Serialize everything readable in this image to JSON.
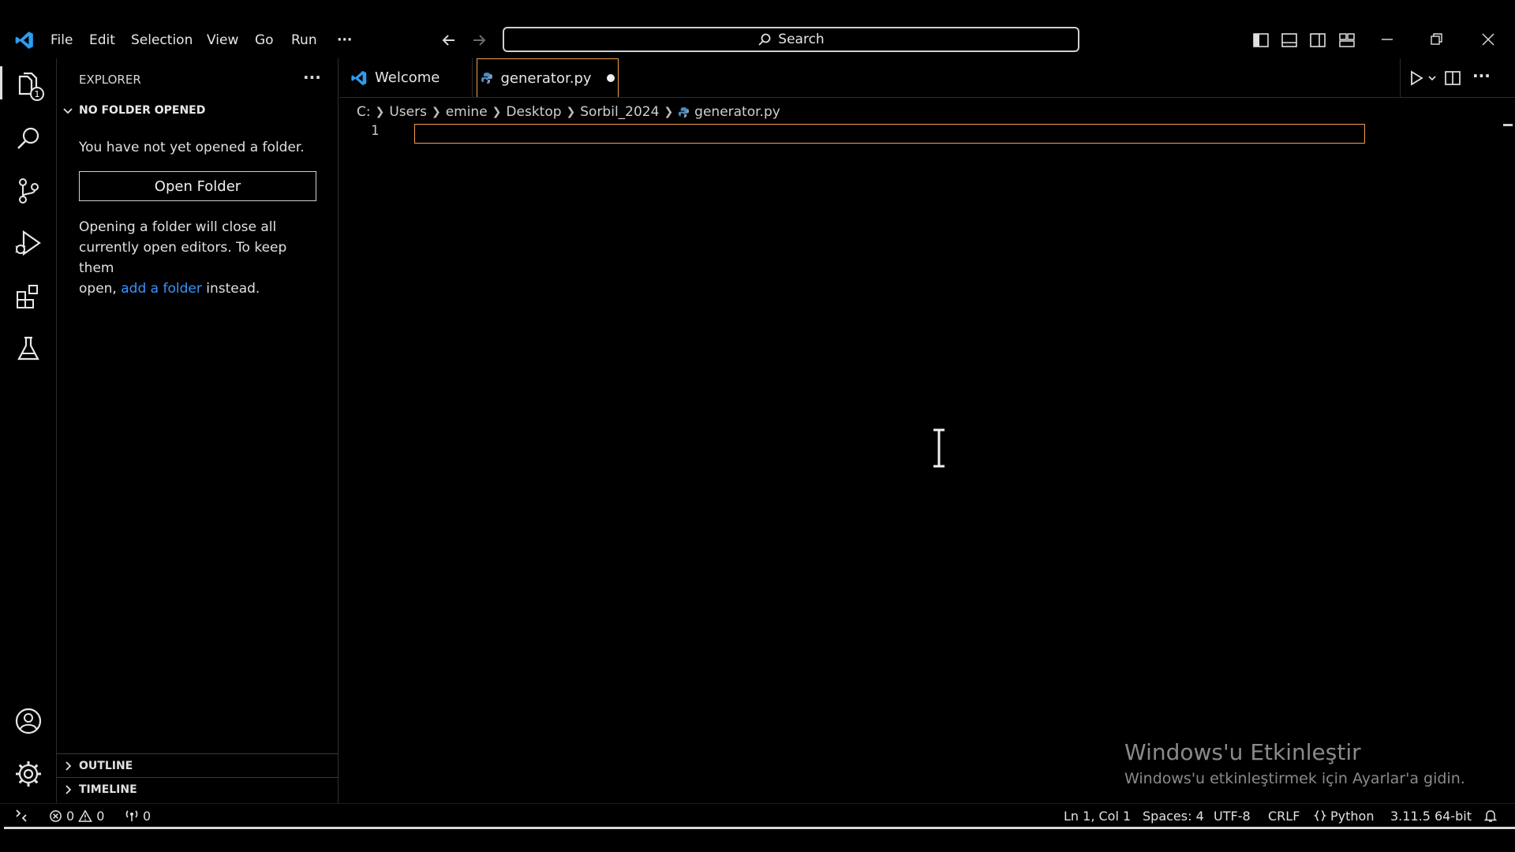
{
  "menu": [
    "File",
    "Edit",
    "Selection",
    "View",
    "Go",
    "Run",
    "···"
  ],
  "search": {
    "label": "Search"
  },
  "activity": {
    "explorer_badge": "1"
  },
  "sidebar": {
    "title": "EXPLORER",
    "more": "···",
    "section_title": "NO FOLDER OPENED",
    "message": "You have not yet opened a folder.",
    "open_folder_label": "Open Folder",
    "info_line1": "Opening a folder will close all",
    "info_line2": "currently open editors. To keep them",
    "info_line3_prefix": "open,",
    "info_link": "add a folder",
    "info_line3_suffix": "instead.",
    "outline_label": "OUTLINE",
    "timeline_label": "TIMELINE"
  },
  "tabs": [
    {
      "label": "Welcome"
    },
    {
      "label": "generator.py",
      "modified": true
    }
  ],
  "editor_actions_more": "···",
  "breadcrumb": [
    "C:",
    "Users",
    "emine",
    "Desktop",
    "Sorbil_2024",
    "generator.py"
  ],
  "editor": {
    "line_number": "1"
  },
  "watermark": {
    "title": "Windows'u Etkinleştir",
    "subtitle": "Windows'u etkinleştirmek için Ayarlar'a gidin."
  },
  "status": {
    "errors": "0",
    "warnings": "0",
    "ports": "0",
    "position": "Ln 1, Col 1",
    "spaces": "Spaces: 4",
    "encoding": "UTF-8",
    "eol": "CRLF",
    "language": "Python",
    "interpreter": "3.11.5 64-bit"
  },
  "colors": {
    "accent": "#f0a050",
    "link": "#3794ff",
    "background": "#000000",
    "vscode_blue": "#2d9cf0"
  }
}
